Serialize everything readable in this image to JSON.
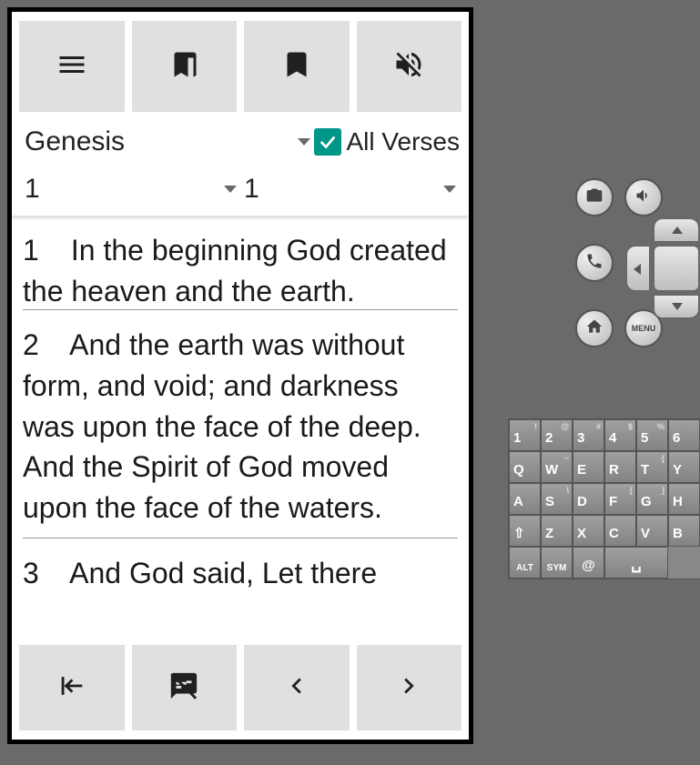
{
  "toolbar_top": {
    "menu": "menu-icon",
    "bookmarks": "bookmarks-icon",
    "bookmark": "bookmark-icon",
    "mute": "volume-off-icon"
  },
  "selector": {
    "book": "Genesis",
    "all_verses_label": "All Verses",
    "all_verses_checked": true,
    "chapter": "1",
    "verse": "1"
  },
  "verses": [
    {
      "num": "1",
      "text": "In the beginning God created the heaven and the earth."
    },
    {
      "num": "2",
      "text": "And the earth was without form, and void; and darkness was upon the face of the deep. And the Spirit of God moved upon the face of the waters."
    },
    {
      "num": "3",
      "text": "And God said, Let there"
    }
  ],
  "toolbar_bottom": {
    "collapse": "collapse-icon",
    "speaker_notes_off": "speaker-notes-off-icon",
    "prev": "chevron-left-icon",
    "next": "chevron-right-icon"
  },
  "emulator_controls": {
    "camera": "camera-icon",
    "volume_up": "volume-up-icon",
    "call": "call-icon",
    "home": "home-icon",
    "menu_label": "MENU"
  },
  "keyboard": {
    "rows": [
      [
        {
          "m": "1",
          "s": "!"
        },
        {
          "m": "2",
          "s": "@"
        },
        {
          "m": "3",
          "s": "#"
        },
        {
          "m": "4",
          "s": "$"
        },
        {
          "m": "5",
          "s": "%"
        },
        {
          "m": "6",
          "s": ""
        }
      ],
      [
        {
          "m": "Q",
          "s": ""
        },
        {
          "m": "W",
          "s": "~"
        },
        {
          "m": "E",
          "s": ""
        },
        {
          "m": "R",
          "s": ""
        },
        {
          "m": "T",
          "s": "{"
        },
        {
          "m": "Y",
          "s": ""
        }
      ],
      [
        {
          "m": "A",
          "s": ""
        },
        {
          "m": "S",
          "s": "\\"
        },
        {
          "m": "D",
          "s": ""
        },
        {
          "m": "F",
          "s": "["
        },
        {
          "m": "G",
          "s": "]"
        },
        {
          "m": "H",
          "s": ""
        }
      ],
      [
        {
          "m": "⇧",
          "s": "",
          "shift": true
        },
        {
          "m": "Z",
          "s": ""
        },
        {
          "m": "X",
          "s": ""
        },
        {
          "m": "C",
          "s": ""
        },
        {
          "m": "V",
          "s": ""
        },
        {
          "m": "B",
          "s": ""
        }
      ],
      [
        {
          "m": "ALT",
          "s": "",
          "alt": true
        },
        {
          "m": "SYM",
          "s": "",
          "sym": true
        },
        {
          "m": "@",
          "s": "",
          "at": true
        },
        {
          "m": "␣",
          "s": "",
          "space": true
        }
      ]
    ]
  }
}
